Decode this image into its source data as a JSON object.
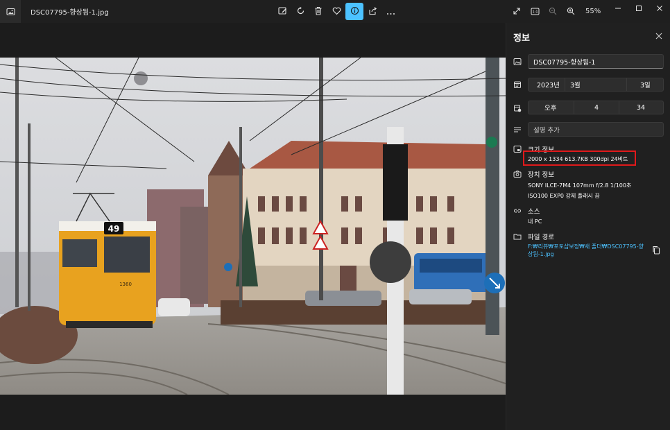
{
  "titlebar": {
    "filename": "DSC07795-향상됨-1.jpg",
    "zoom": "55%"
  },
  "toolbar_icons": [
    "edit-image-icon",
    "rotate-icon",
    "delete-icon",
    "favorite-icon",
    "info-icon",
    "share-icon",
    "more-icon"
  ],
  "panel": {
    "title": "정보",
    "file_name": "DSC07795-향상됨-1",
    "date": {
      "year": "2023년",
      "month": "3월",
      "day": "3일"
    },
    "time": {
      "ampm": "오후",
      "hour": "4",
      "minute": "34"
    },
    "description_placeholder": "설명 추가",
    "size": {
      "title": "크기 정보",
      "values": "2000 x 1334   613.7KB   300dpi   24비트"
    },
    "device": {
      "title": "장치 정보",
      "line1": "SONY   ILCE-7M4   107mm   f/2.8   1/100초",
      "line2": "ISO100   EXP0   강제 플래시 끔"
    },
    "source": {
      "title": "소스",
      "value": "내 PC"
    },
    "path": {
      "title": "파일 경로",
      "value": "F:₩리뷰₩포토샵보정₩새 폴더₩DSC07795-향상됨-1.jpg"
    }
  },
  "photo_badge_number": "49",
  "photo_bus_number": "1360"
}
